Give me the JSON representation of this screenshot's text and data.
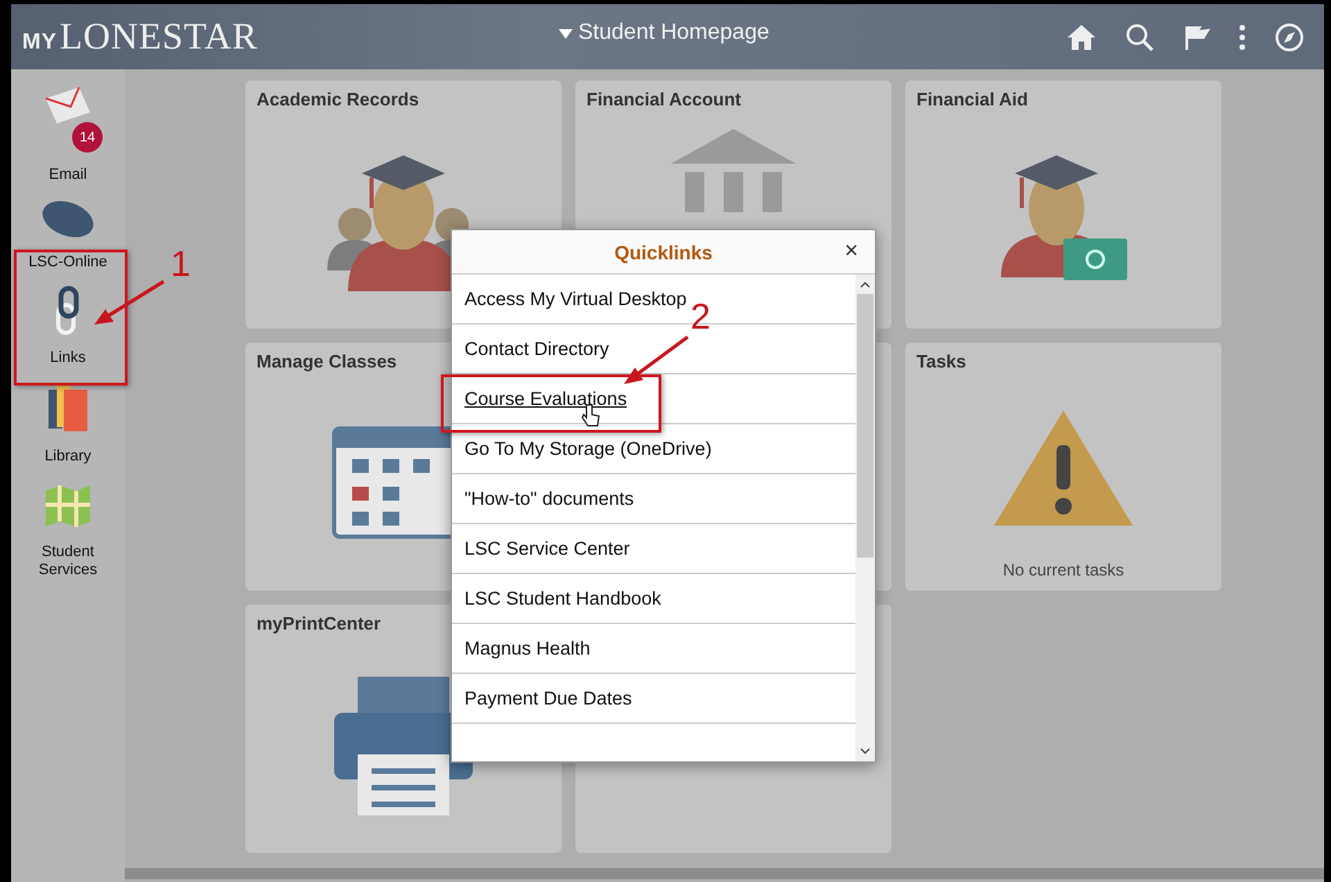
{
  "header": {
    "logo_prefix": "MY",
    "logo": "LONESTAR",
    "title": "Student Homepage"
  },
  "sidebar": {
    "items": [
      {
        "kind": "email",
        "label": "Email",
        "badge": "14"
      },
      {
        "kind": "mouse",
        "label": "LSC-Online"
      },
      {
        "kind": "links",
        "label": "Links"
      },
      {
        "kind": "library",
        "label": "Library"
      },
      {
        "kind": "services",
        "label": "Student Services"
      }
    ]
  },
  "tiles": [
    {
      "kind": "academic",
      "title": "Academic Records"
    },
    {
      "kind": "bank",
      "title": "Financial Account"
    },
    {
      "kind": "aid",
      "title": "Financial Aid"
    },
    {
      "kind": "calendar",
      "title": "Manage Classes"
    },
    {
      "kind": "covered"
    },
    {
      "kind": "tasks",
      "title": "Tasks",
      "note": "No current tasks"
    },
    {
      "kind": "printer",
      "title": "myPrintCenter"
    },
    {
      "kind": "covered"
    }
  ],
  "quicklinks": {
    "title": "Quicklinks",
    "close": "×",
    "items": [
      {
        "label": "Access My Virtual Desktop",
        "hovered": false
      },
      {
        "label": "Contact Directory",
        "hovered": false
      },
      {
        "label": "Course Evaluations",
        "hovered": true
      },
      {
        "label": "Go To My Storage (OneDrive)",
        "hovered": false
      },
      {
        "label": "\"How-to\" documents",
        "hovered": false
      },
      {
        "label": "LSC Service Center",
        "hovered": false
      },
      {
        "label": "LSC Student Handbook",
        "hovered": false
      },
      {
        "label": "Magnus Health",
        "hovered": false
      },
      {
        "label": "Payment Due Dates",
        "hovered": false
      }
    ]
  },
  "annotations": [
    {
      "label": "1"
    },
    {
      "label": "2"
    }
  ]
}
